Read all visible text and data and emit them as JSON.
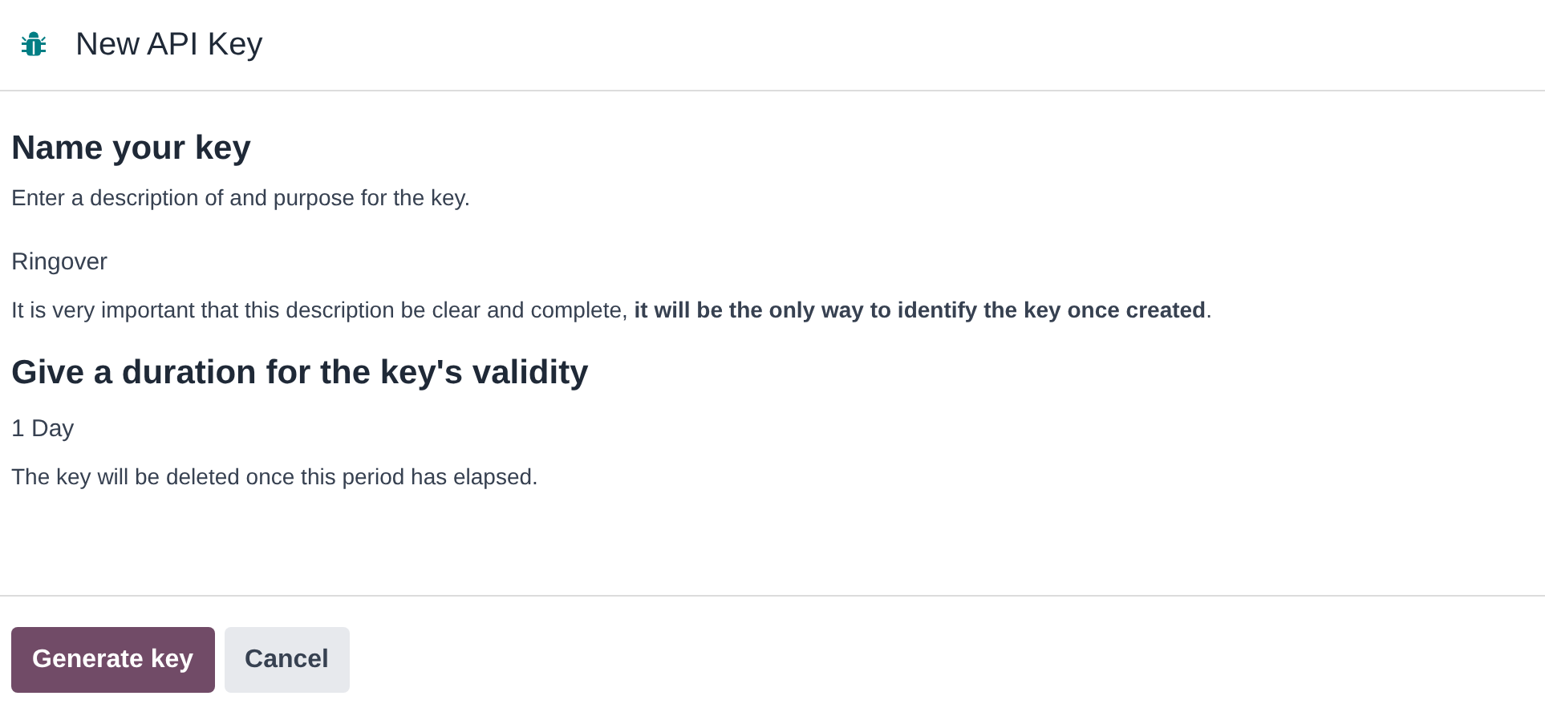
{
  "dialog": {
    "title": "New API Key"
  },
  "sections": [
    {
      "heading": "Name your key",
      "intro": "Enter a description of and purpose for the key.",
      "field_value": "Ringover",
      "note": "It is very important that this description be clear and complete, **it will be the only way to identify the key once created**."
    },
    {
      "heading": "Give a duration for the key's validity",
      "field_value": "1 Day",
      "note": "The key will be deleted once this period has elapsed."
    }
  ],
  "buttons": [
    {
      "label": "Generate key",
      "kind": "primary"
    },
    {
      "label": "Cancel",
      "kind": "secondary"
    }
  ]
}
